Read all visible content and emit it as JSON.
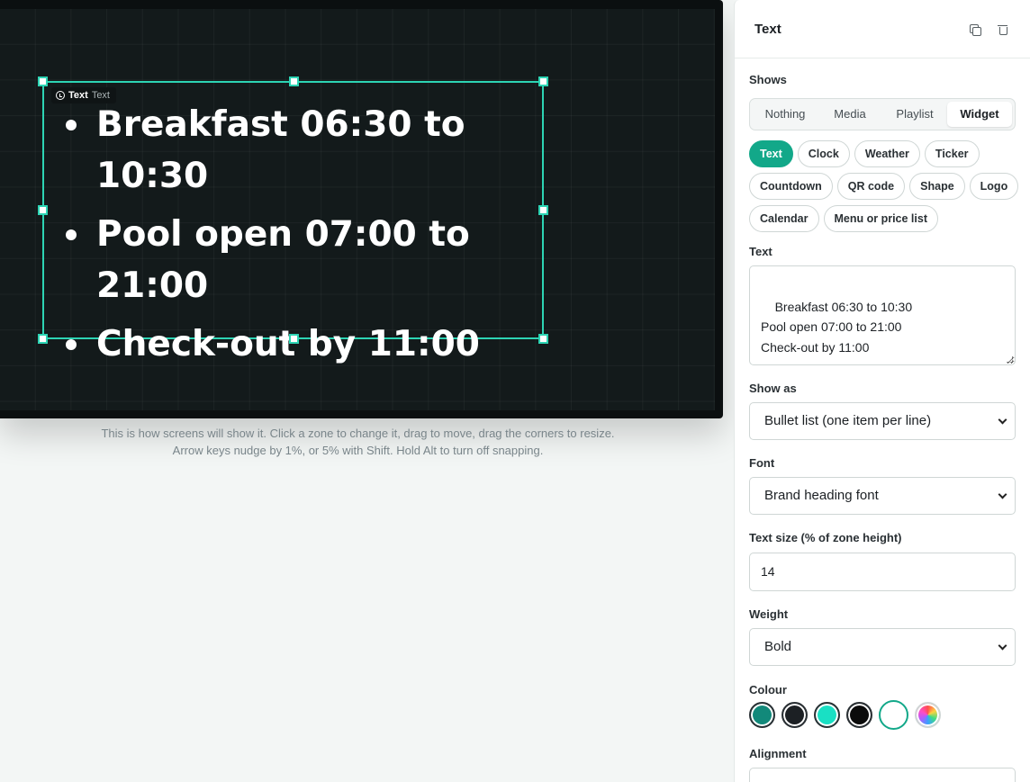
{
  "preview": {
    "zone_tag_type": "Text",
    "zone_tag_label": "Text",
    "items": [
      "Breakfast 06:30 to 10:30",
      "Pool open 07:00 to 21:00",
      "Check-out by 11:00"
    ],
    "hint": "This is how screens will show it. Click a zone to change it, drag to move, drag the corners to resize. Arrow keys nudge by 1%, or 5% with Shift. Hold Alt to turn off snapping."
  },
  "panel": {
    "title": "Text",
    "shows_label": "Shows",
    "shows_options": [
      "Nothing",
      "Media",
      "Playlist",
      "Widget"
    ],
    "shows_selected": "Widget",
    "widgets": [
      "Text",
      "Clock",
      "Weather",
      "Ticker",
      "Countdown",
      "QR code",
      "Shape",
      "Logo",
      "Calendar",
      "Menu or price list"
    ],
    "widget_selected": "Text",
    "text_label": "Text",
    "text_value": "Breakfast 06:30 to 10:30\nPool open 07:00 to 21:00\nCheck-out by 11:00",
    "show_as_label": "Show as",
    "show_as_value": "Bullet list (one item per line)",
    "font_label": "Font",
    "font_value": "Brand heading font",
    "size_label": "Text size (% of zone height)",
    "size_value": "14",
    "weight_label": "Weight",
    "weight_value": "Bold",
    "colour_label": "Colour",
    "colours": [
      "#12897a",
      "#1c2024",
      "#19e0c4",
      "#0b0b0b",
      "#ffffff",
      "custom"
    ],
    "colour_selected": "#ffffff",
    "alignment_label": "Alignment"
  }
}
